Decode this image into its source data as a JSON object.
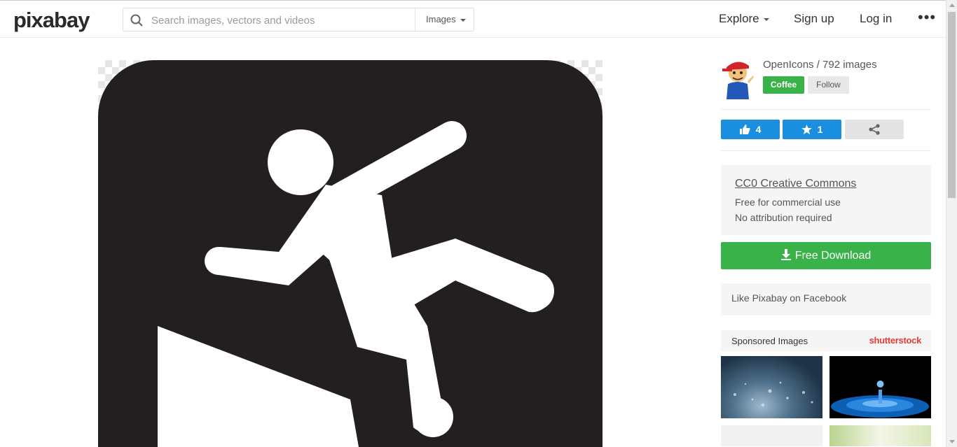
{
  "header": {
    "logo": "pixabay",
    "search_placeholder": "Search images, vectors and videos",
    "search_type": "Images",
    "nav": {
      "explore": "Explore",
      "signup": "Sign up",
      "login": "Log in",
      "more": "•••"
    }
  },
  "sidebar": {
    "author": "OpenIcons / 792 images",
    "coffee_label": "Coffee",
    "follow_label": "Follow",
    "likes": "4",
    "favorites": "1",
    "license": {
      "title": "CC0 Creative Commons",
      "line1": "Free for commercial use",
      "line2": "No attribution required"
    },
    "download_label": "Free Download",
    "facebook_label": "Like Pixabay on Facebook",
    "sponsored_label": "Sponsored Images",
    "sponsor_brand": "shutterstock"
  },
  "colors": {
    "green": "#3ab24a",
    "blue": "#1a8fe0",
    "icon_bg": "#231f20"
  }
}
